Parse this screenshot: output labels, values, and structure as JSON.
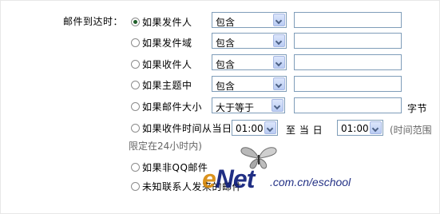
{
  "section_label": "邮件到达时：",
  "rules": [
    {
      "label": "如果发件人",
      "checked": true,
      "select": "包含"
    },
    {
      "label": "如果发件域",
      "checked": false,
      "select": "包含"
    },
    {
      "label": "如果收件人",
      "checked": false,
      "select": "包含"
    },
    {
      "label": "如果主题中",
      "checked": false,
      "select": "包含"
    },
    {
      "label": "如果邮件大小",
      "checked": false,
      "select": "大于等于",
      "unit": "字节"
    }
  ],
  "time_rule": {
    "label": "如果收件时间从当日",
    "start": "01:00",
    "to_label": "至 当 日",
    "end": "01:00",
    "note_line1": "(时间范围",
    "note_line2": "限定在24小时内)"
  },
  "non_qq_rule": {
    "label": "如果非QQ邮件"
  },
  "unknown_rule": {
    "label": "未知联系人发来的邮件"
  },
  "watermark": {
    "brand_e": "e",
    "brand_rest": "Net",
    "url": ".com.cn/eschool"
  }
}
